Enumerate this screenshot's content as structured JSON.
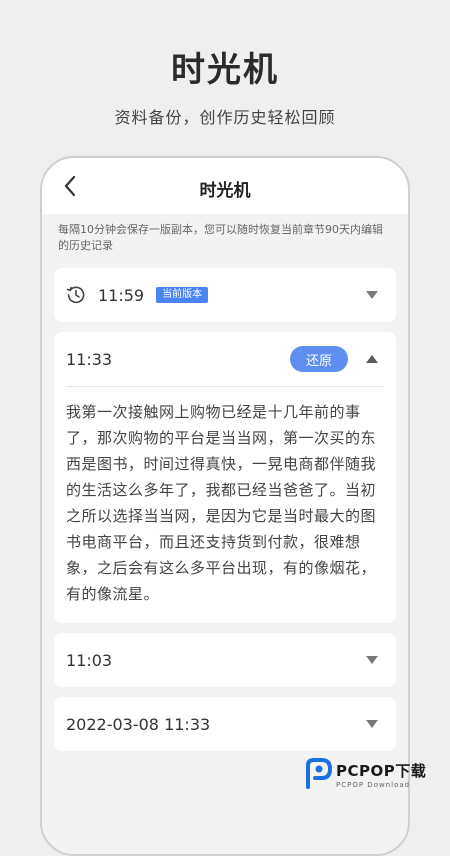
{
  "promo": {
    "headline": "时光机",
    "subhead": "资料备份，创作历史轻松回顾"
  },
  "navbar": {
    "title": "时光机",
    "back_icon": "chevron-left-icon"
  },
  "notice": "每隔10分钟会保存一版副本，您可以随时恢复当前章节90天内编辑的历史记录",
  "versions": [
    {
      "time": "11:59",
      "badge": "当前版本",
      "expanded": false
    },
    {
      "time": "11:33",
      "restore_label": "还原",
      "expanded": true,
      "content": "我第一次接触网上购物已经是十几年前的事了，那次购物的平台是当当网，第一次买的东西是图书，时间过得真快，一晃电商都伴随我的生活这么多年了，我都已经当爸爸了。当初之所以选择当当网，是因为它是当时最大的图书电商平台，而且还支持货到付款，很难想象，之后会有这么多平台出现，有的像烟花，有的像流星。"
    },
    {
      "time": "11:03",
      "expanded": false
    },
    {
      "time": "2022-03-08 11:33",
      "expanded": false
    }
  ],
  "watermark": {
    "main": "PCPOP下载",
    "sub": "PCPOP Download"
  },
  "colors": {
    "accent": "#5e8ff0",
    "badge": "#4a84f0"
  }
}
